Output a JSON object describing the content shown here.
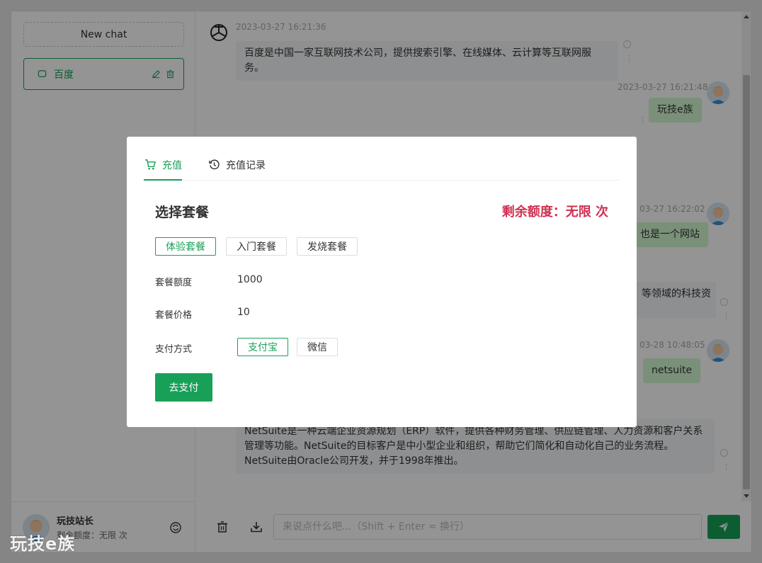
{
  "sidebar": {
    "new_chat": "New chat",
    "chats": [
      {
        "label": "百度"
      }
    ],
    "user": {
      "name": "玩技站长",
      "quota": "剩余额度：无限 次"
    }
  },
  "messages": [
    {
      "role": "ai",
      "time": "2023-03-27 16:21:36",
      "text": "百度是中国一家互联网技术公司，提供搜索引擎、在线媒体、云计算等互联网服务。"
    },
    {
      "role": "user",
      "time": "2023-03-27 16:21:48",
      "text": "玩技e族"
    },
    {
      "role": "user",
      "time": "03-27 16:22:02",
      "text": "也是一个网站"
    },
    {
      "role": "ai",
      "time": "",
      "text": "等领域的科技资"
    },
    {
      "role": "user",
      "time": "03-28 10:48:05",
      "text": "netsuite"
    },
    {
      "role": "ai",
      "time": "",
      "text": "NetSuite是一种云端企业资源规划（ERP）软件，提供各种财务管理、供应链管理、人力资源和客户关系管理等功能。NetSuite的目标客户是中小型企业和组织，帮助它们简化和自动化自己的业务流程。NetSuite由Oracle公司开发，并于1998年推出。"
    }
  ],
  "input": {
    "placeholder": "来说点什么吧...（Shift + Enter = 换行）"
  },
  "modal": {
    "tabs": [
      {
        "label": "充值"
      },
      {
        "label": "充值记录"
      }
    ],
    "section_title": "选择套餐",
    "remaining": "剩余额度：无限 次",
    "packages": [
      "体验套餐",
      "入门套餐",
      "发烧套餐"
    ],
    "quota_label": "套餐额度",
    "quota_value": "1000",
    "price_label": "套餐价格",
    "price_value": "10",
    "pay_label": "支付方式",
    "pay_methods": [
      "支付宝",
      "微信"
    ],
    "pay_button": "去支付"
  },
  "watermark": "玩技e族",
  "colors": {
    "accent": "#18a058",
    "alert": "#d03050"
  }
}
